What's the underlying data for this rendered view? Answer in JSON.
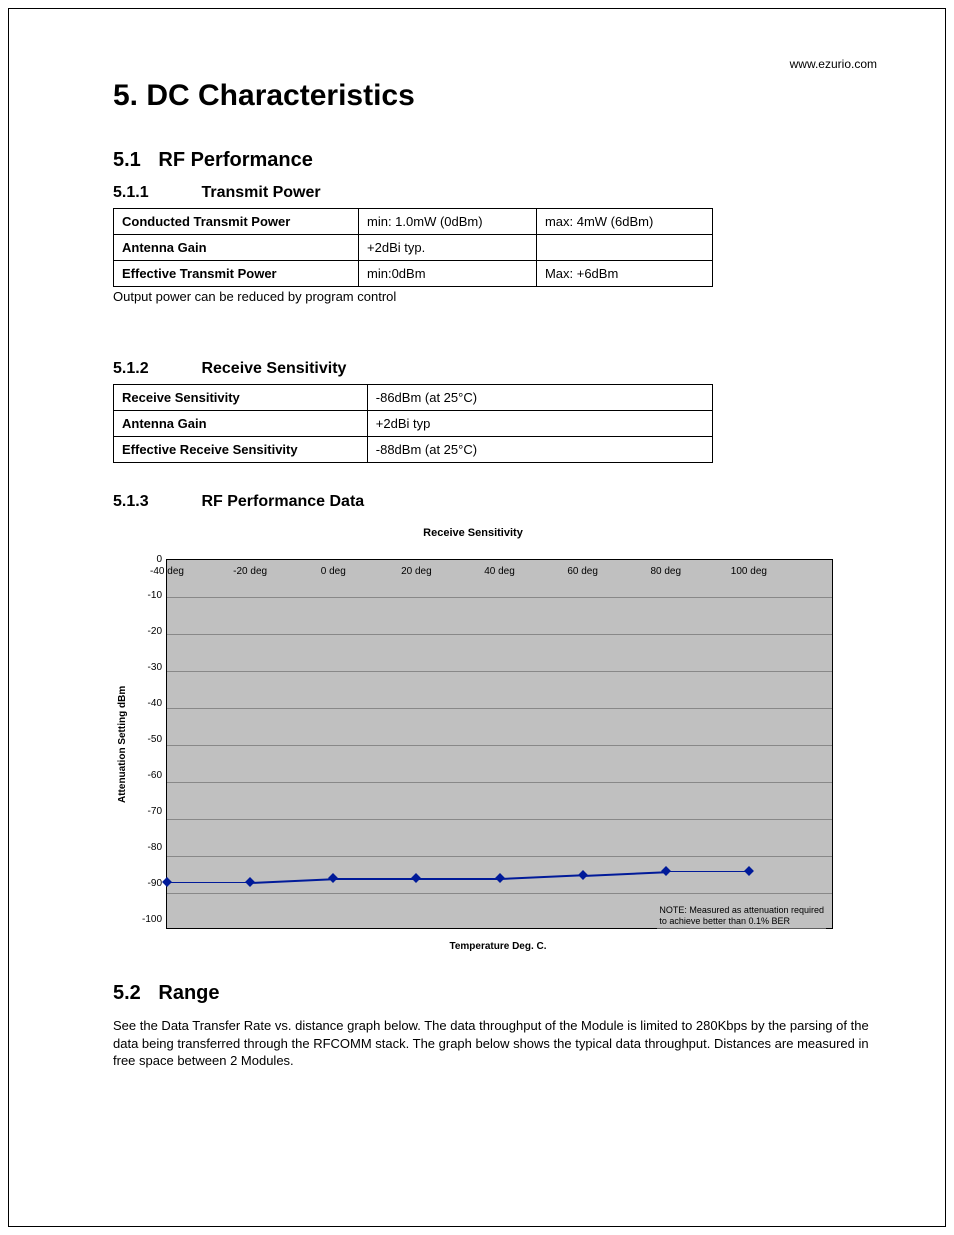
{
  "header": {
    "url": "www.ezurio.com"
  },
  "h1": "5.   DC Characteristics",
  "s51": {
    "num": "5.1",
    "title": "RF Performance"
  },
  "s511": {
    "num": "5.1.1",
    "title": "Transmit Power",
    "rows": [
      {
        "label": "Conducted Transmit Power",
        "c1": "min: 1.0mW (0dBm)",
        "c2": "max: 4mW (6dBm)"
      },
      {
        "label": "Antenna Gain",
        "c1": "+2dBi typ.",
        "c2": ""
      },
      {
        "label": "Effective Transmit Power",
        "c1": "min:0dBm",
        "c2": "Max: +6dBm"
      }
    ],
    "caption": "Output power can be reduced by program control"
  },
  "s512": {
    "num": "5.1.2",
    "title": "Receive Sensitivity",
    "rows": [
      {
        "label": "Receive Sensitivity",
        "c1": "-86dBm (at 25°C)"
      },
      {
        "label": "Antenna Gain",
        "c1": "+2dBi typ"
      },
      {
        "label": "Effective Receive Sensitivity",
        "c1": "-88dBm (at 25°C)"
      }
    ]
  },
  "s513": {
    "num": "5.1.3",
    "title": "RF Performance Data"
  },
  "s52": {
    "num": "5.2",
    "title": "Range",
    "para": "See the Data Transfer Rate vs. distance graph below. The data throughput of the Module is limited to 280Kbps by the parsing of the data being transferred through the RFCOMM stack.  The graph below shows the typical data throughput. Distances are measured in free space between 2 Modules."
  },
  "chart_data": {
    "type": "line",
    "title": "Receive Sensitivity",
    "xlabel": "Temperature Deg. C.",
    "ylabel": "Attenuation Setting dBm",
    "ylim": [
      -100,
      0
    ],
    "yticks": [
      0,
      -10,
      -20,
      -30,
      -40,
      -50,
      -60,
      -70,
      -80,
      -90,
      -100
    ],
    "xticks_labels": [
      "-40 deg",
      "-20 deg",
      "0 deg",
      "20 deg",
      "40 deg",
      "60 deg",
      "80 deg",
      "100 deg"
    ],
    "xticks_values": [
      -40,
      -20,
      0,
      20,
      40,
      60,
      80,
      100
    ],
    "xlim": [
      -40,
      120
    ],
    "series": [
      {
        "name": "Receive Sensitivity",
        "x": [
          -40,
          -20,
          0,
          20,
          40,
          60,
          80,
          100
        ],
        "y": [
          -87,
          -87,
          -86,
          -86,
          -86,
          -85,
          -84,
          -84
        ]
      }
    ],
    "note": [
      "NOTE: Measured as attenuation required",
      "to achieve better than 0.1% BER"
    ]
  }
}
